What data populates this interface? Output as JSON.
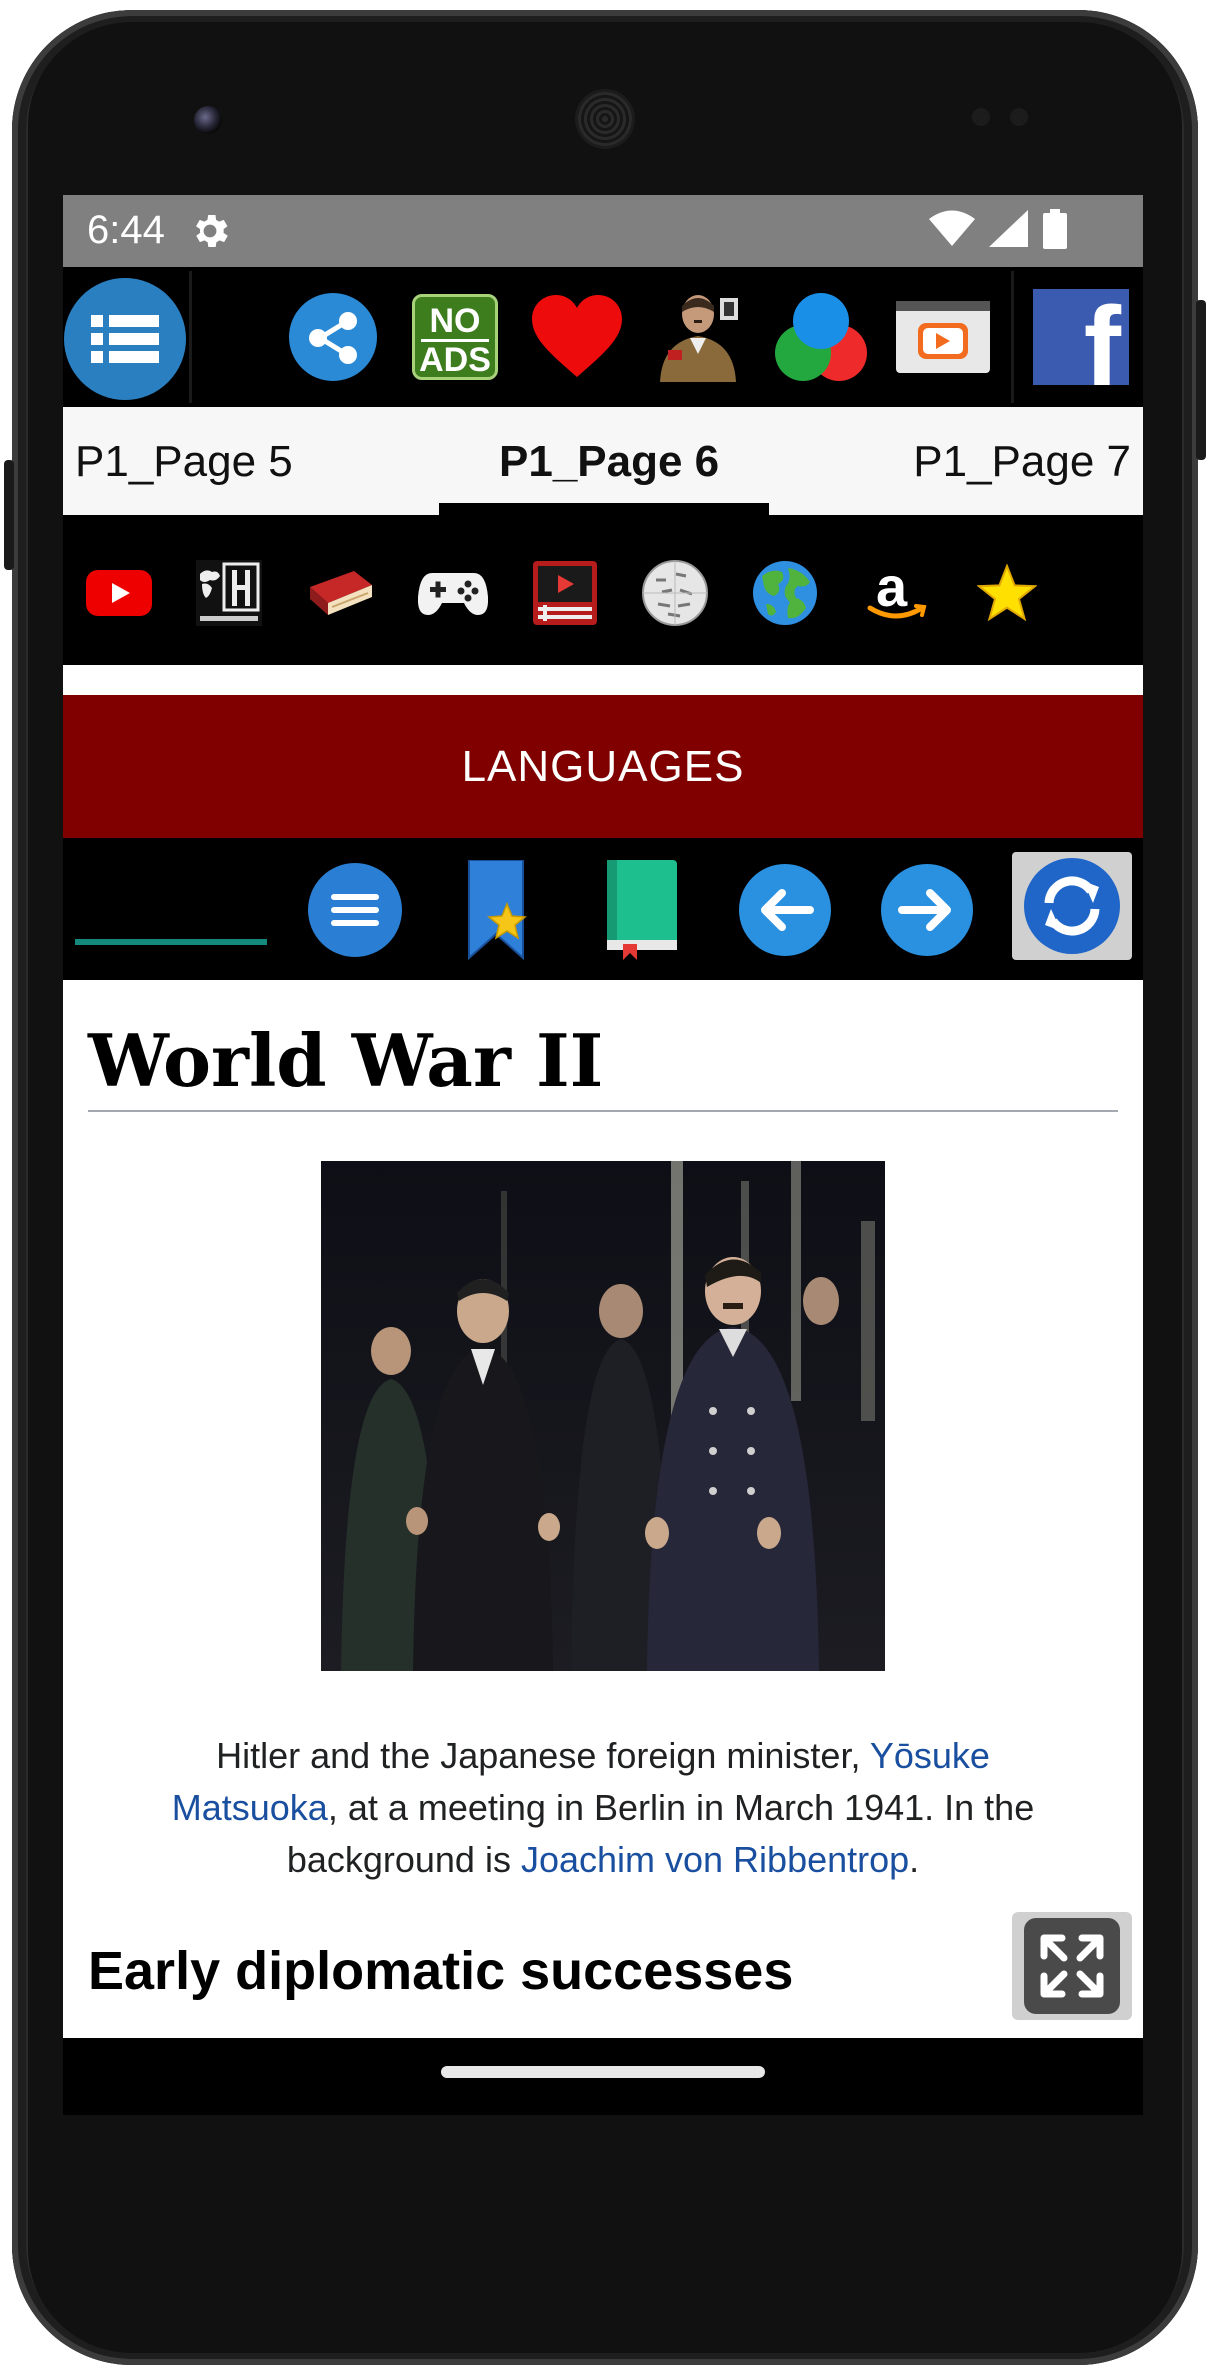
{
  "status_bar": {
    "time": "6:44"
  },
  "toolbar": {
    "icons": [
      "menu-icon",
      "share-icon",
      "no-ads-icon",
      "heart-icon",
      "portrait-icon",
      "color-circles-icon",
      "video-player-icon",
      "facebook-icon"
    ],
    "no_ads_line1": "NO",
    "no_ads_line2": "ADS",
    "facebook_letter": "f"
  },
  "page_tabs": [
    {
      "label": "P1_Page 5",
      "active": false
    },
    {
      "label": "P1_Page 6",
      "active": true
    },
    {
      "label": "P1_Page 7",
      "active": false
    }
  ],
  "icon_bar": {
    "icons": [
      "youtube-icon",
      "histaprexius-icon",
      "book-icon",
      "gamepad-icon",
      "video-icon",
      "wikipedia-icon",
      "globe-icon",
      "amazon-icon",
      "star-icon"
    ],
    "amazon_letter": "a"
  },
  "languages_label": "LANGUAGES",
  "nav_bar": {
    "icons": [
      "hamburger-icon",
      "bookmark-star-icon",
      "green-book-icon",
      "arrow-left-icon",
      "arrow-right-icon",
      "refresh-icon"
    ]
  },
  "article": {
    "title": "World War II",
    "caption": {
      "text_1": "Hitler and the Japanese foreign minister, ",
      "link_1": "Yōsuke Matsuoka",
      "text_2": ", at a meeting in Berlin in March 1941. In the background is ",
      "link_2": "Joachim von Ribbentrop",
      "text_3": "."
    },
    "section_heading": "Early diplomatic successes"
  },
  "colors": {
    "languages_bar": "#800000",
    "link": "#1a4fa0",
    "status_bar": "#808080",
    "nav_accent": "#138a7c"
  }
}
